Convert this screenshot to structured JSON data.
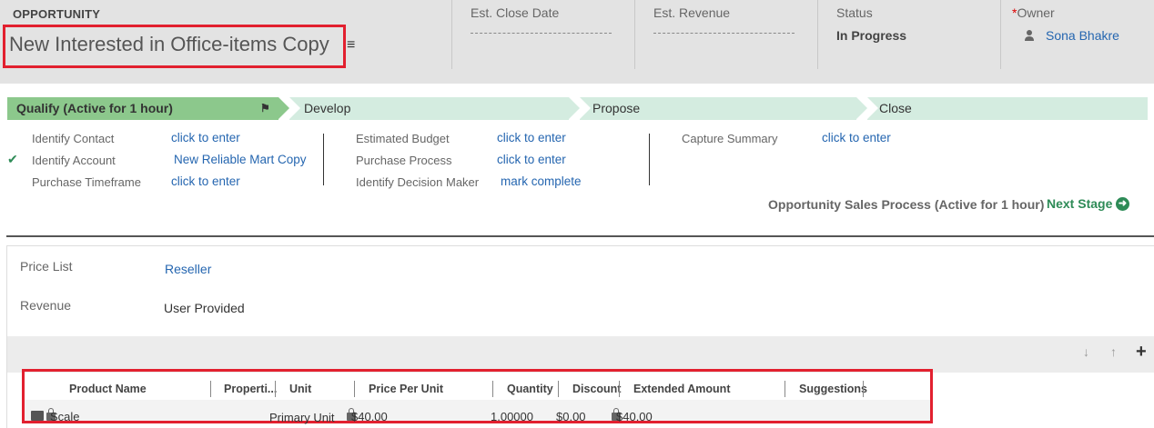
{
  "header": {
    "entity_label": "OPPORTUNITY",
    "title": "New Interested in Office-items Copy",
    "title_menu_icon": "menu-icon",
    "fields": {
      "close_date_label": "Est. Close Date",
      "revenue_label": "Est. Revenue",
      "status_label": "Status",
      "status_value": "In Progress",
      "owner_required": "*",
      "owner_label": "Owner",
      "owner_value": "Sona Bhakre",
      "owner_icon": "user-icon"
    }
  },
  "process": {
    "stages": [
      {
        "label": "Qualify (Active for 1 hour)",
        "active": true
      },
      {
        "label": "Develop",
        "active": false
      },
      {
        "label": "Propose",
        "active": false
      },
      {
        "label": "Close",
        "active": false
      }
    ],
    "flag_icon": "flag-icon",
    "active_color": "#8cc88c",
    "inactive_color": "#d4ece0",
    "steps_col1": [
      {
        "label": "Identify Contact",
        "value": "click to enter"
      },
      {
        "label": "Identify Account",
        "value": "New Reliable Mart Copy",
        "checked": true
      },
      {
        "label": "Purchase Timeframe",
        "value": "click to enter"
      }
    ],
    "steps_col2": [
      {
        "label": "Estimated Budget",
        "value": "click to enter"
      },
      {
        "label": "Purchase Process",
        "value": "click to enter"
      },
      {
        "label": "Identify Decision Maker",
        "value": "mark complete"
      }
    ],
    "steps_col3": [
      {
        "label": "Capture Summary",
        "value": "click to enter"
      }
    ],
    "check_icon": "checkmark-icon",
    "process_name": "Opportunity Sales Process (Active for 1 hour)",
    "next_stage_label": "Next Stage",
    "next_icon": "arrow-right-circle-icon"
  },
  "form": {
    "price_list_label": "Price List",
    "price_list_value": "Reseller",
    "revenue_label": "Revenue",
    "revenue_value": "User Provided"
  },
  "products": {
    "toolbar_icons": [
      "arrow-down-icon",
      "arrow-up-icon",
      "plus-icon"
    ],
    "columns": [
      "Product Name",
      "Properti...",
      "Unit",
      "Price Per Unit",
      "Quantity",
      "Discount",
      "Extended Amount",
      "Suggestions"
    ],
    "rows": [
      {
        "product": "Scale",
        "unit": "Primary Unit",
        "price": "$40.00",
        "quantity": "1.00000",
        "discount": "$0.00",
        "extended": "$40.00"
      }
    ]
  },
  "colors": {
    "link": "#2566b0",
    "highlight_border": "#e2202f",
    "next_stage": "#2e8b57"
  }
}
